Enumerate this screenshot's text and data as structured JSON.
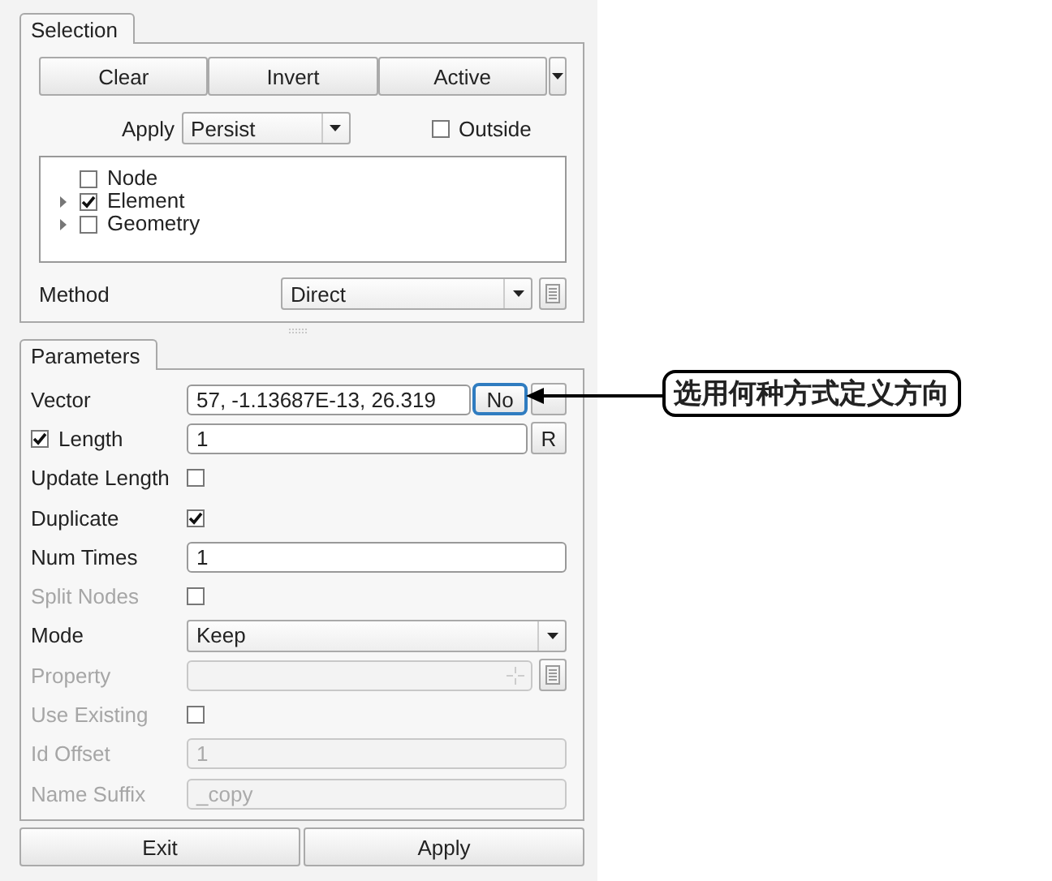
{
  "selection": {
    "tab": "Selection",
    "buttons": [
      "Clear",
      "Invert",
      "Active"
    ],
    "apply": {
      "label": "Apply",
      "value": "Persist"
    },
    "outside": {
      "label": "Outside",
      "checked": false
    },
    "tree": [
      {
        "label": "Node",
        "checked": false,
        "expandable": false
      },
      {
        "label": "Element",
        "checked": true,
        "expandable": true
      },
      {
        "label": "Geometry",
        "checked": false,
        "expandable": true
      }
    ],
    "method": {
      "label": "Method",
      "value": "Direct"
    }
  },
  "parameters": {
    "tab": "Parameters",
    "rows": [
      {
        "kind": "vector",
        "label": "Vector",
        "value": "57, -1.13687E-13, 26.319",
        "toggle": "No",
        "disabled": false
      },
      {
        "kind": "checkfield",
        "label": "Length",
        "checked": true,
        "value": "1",
        "button": "R",
        "disabled": false
      },
      {
        "kind": "checkbox",
        "label": "Update Length",
        "checked": false,
        "disabled": false
      },
      {
        "kind": "checkbox",
        "label": "Duplicate",
        "checked": true,
        "disabled": false
      },
      {
        "kind": "field",
        "label": "Num Times",
        "value": "1",
        "disabled": false
      },
      {
        "kind": "checkbox",
        "label": "Split Nodes",
        "checked": false,
        "disabled": true
      },
      {
        "kind": "select",
        "label": "Mode",
        "value": "Keep",
        "disabled": false
      },
      {
        "kind": "picker",
        "label": "Property",
        "disabled": true
      },
      {
        "kind": "checkbox",
        "label": "Use Existing",
        "checked": false,
        "disabled": true
      },
      {
        "kind": "field",
        "label": "Id Offset",
        "value": "1",
        "disabled": true
      },
      {
        "kind": "field",
        "label": "Name Suffix",
        "value": "_copy",
        "disabled": true
      }
    ]
  },
  "footer": {
    "buttons": [
      "Exit",
      "Apply"
    ]
  },
  "annotation": {
    "text": "选用何种方式定义方向"
  }
}
